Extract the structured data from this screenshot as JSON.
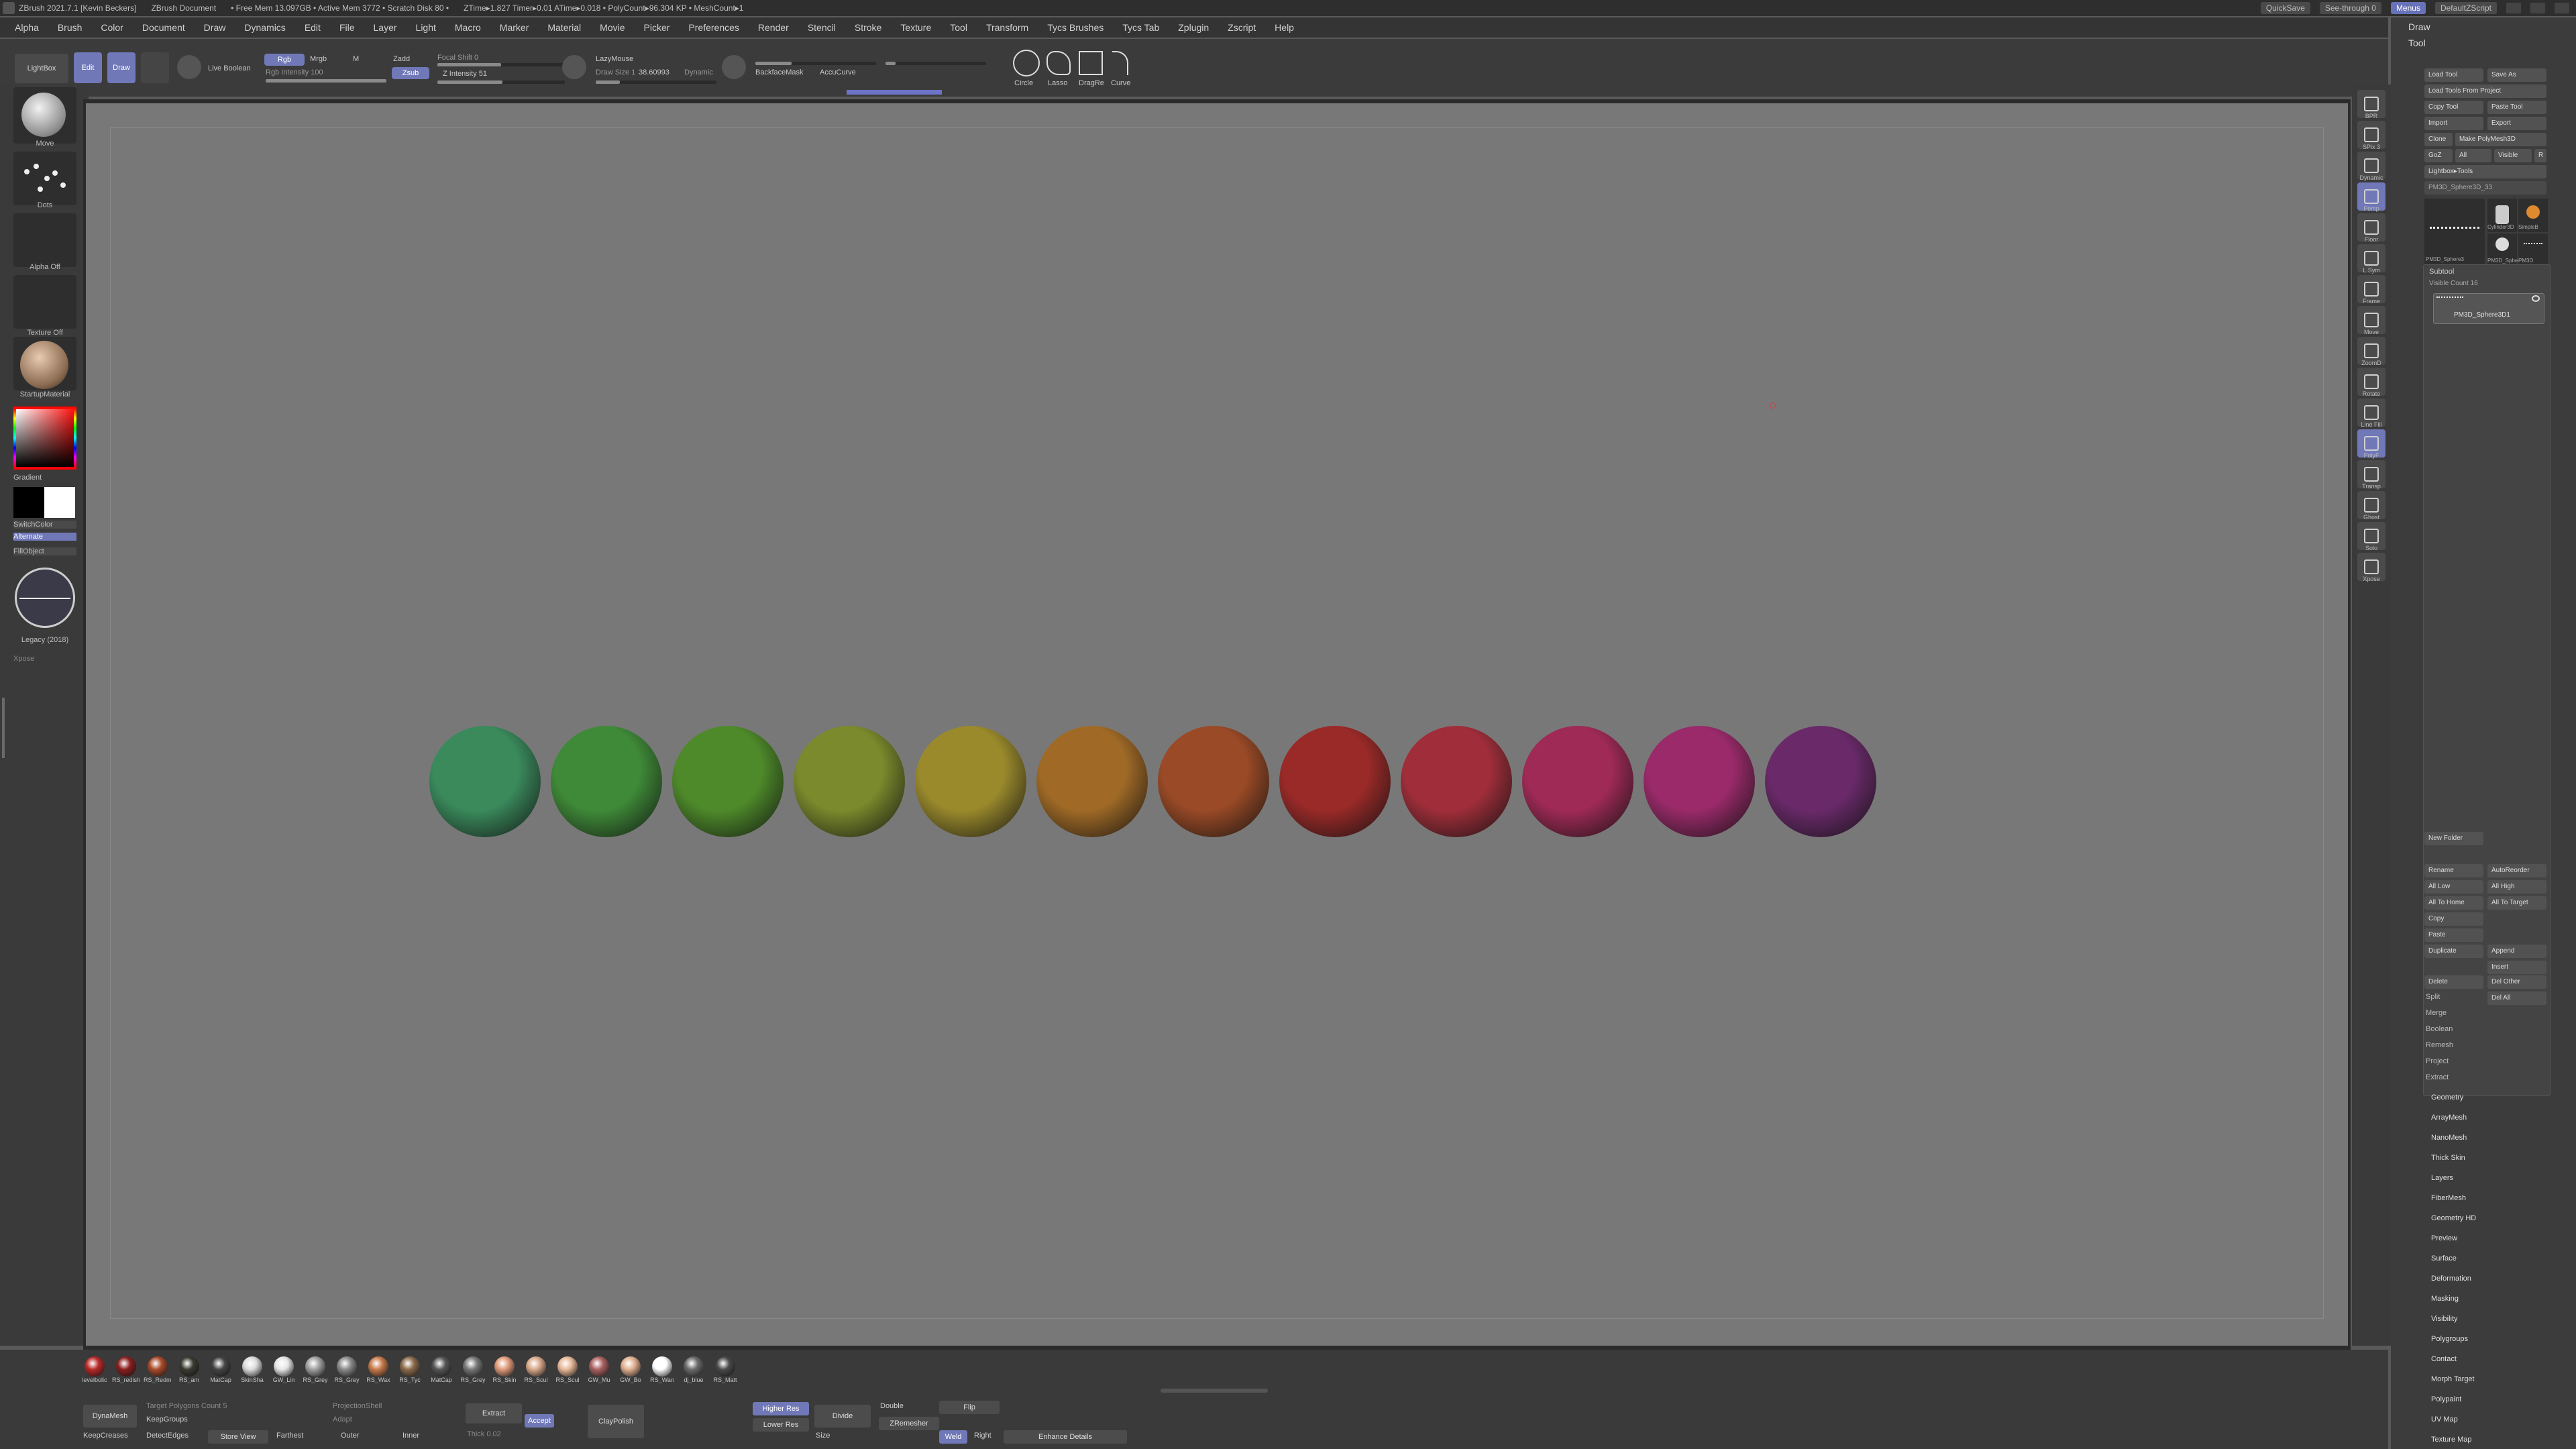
{
  "titlebar": {
    "app": "ZBrush 2021.7.1 [Kevin Beckers]",
    "document": "ZBrush Document",
    "stats": "• Free Mem 13.097GB • Active Mem 3772 • Scratch Disk 80 •",
    "timers": "ZTime▸1.827 Timer▸0.01 ATime▸0.018 • PolyCount▸96.304 KP • MeshCount▸1",
    "quicksave": "QuickSave",
    "seethrough": "See-through 0",
    "menus": "Menus",
    "script": "DefaultZScript"
  },
  "menus": [
    "Alpha",
    "Brush",
    "Color",
    "Document",
    "Draw",
    "Dynamics",
    "Edit",
    "File",
    "Layer",
    "Light",
    "Macro",
    "Marker",
    "Material",
    "Movie",
    "Picker",
    "Preferences",
    "Render",
    "Stencil",
    "Stroke",
    "Texture",
    "Tool",
    "Transform",
    "Tycs Brushes",
    "Tycs Tab",
    "Zplugin",
    "Zscript",
    "Help"
  ],
  "topshelf": {
    "lightbox": "LightBox",
    "edit": "Edit",
    "draw": "Draw",
    "live_boolean": "Live Boolean",
    "rgb": "Rgb",
    "mrgb": "Mrgb",
    "m": "M",
    "rgb_intensity": "Rgb Intensity 100",
    "zadd": "Zadd",
    "zsub": "Zsub",
    "focal_shift": "Focal Shift 0",
    "z_intensity": "Z Intensity 51",
    "draw_size": "Draw Size 1",
    "lazymouse": "LazyMouse",
    "lazyradius": "38.60993",
    "dynamic": "Dynamic",
    "backfacemask": "BackfaceMask",
    "accucurve": "AccuCurve",
    "strokes": [
      "Circle",
      "Lasso",
      "DragRe",
      "Curve"
    ]
  },
  "leftshelf": {
    "brush": "Move",
    "stroke": "Dots",
    "alpha": "Alpha Off",
    "texture": "Texture Off",
    "material": "StartupMaterial",
    "gradient": "Gradient",
    "switchcolor": "SwitchColor",
    "alternate": "Alternate",
    "fillobject": "FillObject",
    "legacy": "Legacy (2018)",
    "xpose": "Xpose"
  },
  "canvas": {
    "balls": [
      {
        "name": "teal-green",
        "color": "#3a8a5c"
      },
      {
        "name": "green",
        "color": "#3f8a38"
      },
      {
        "name": "grass-green",
        "color": "#4e8a2a"
      },
      {
        "name": "olive",
        "color": "#7a8a2c"
      },
      {
        "name": "mustard",
        "color": "#9a8a2c"
      },
      {
        "name": "ochre",
        "color": "#a06a26"
      },
      {
        "name": "rust",
        "color": "#9a4a26"
      },
      {
        "name": "red",
        "color": "#9a2a28"
      },
      {
        "name": "crimson",
        "color": "#a02e3a"
      },
      {
        "name": "raspberry",
        "color": "#a02a56"
      },
      {
        "name": "magenta",
        "color": "#9a2a6a"
      },
      {
        "name": "purple",
        "color": "#6a2a6a"
      }
    ]
  },
  "rightshelf": {
    "items": [
      "BPR",
      "SPix 3",
      "Dynamic",
      "Persp",
      "Floor",
      "L.Sym",
      "Frame",
      "Move",
      "ZoomD",
      "Rotate",
      "Line Fill",
      "PolyF",
      "Transp",
      "Ghost",
      "Solo",
      "Xpose"
    ]
  },
  "toolpanel": {
    "draw_header": "Draw",
    "tool_header": "Tool",
    "buttons": [
      "Load Tool",
      "Save As",
      "Load Tools From Project",
      "Copy Tool",
      "Paste Tool",
      "Import",
      "Export",
      "Clone",
      "Make PolyMesh3D",
      "GoZ",
      "All",
      "Visible",
      "R",
      "Lightbox▸Tools"
    ],
    "current_tool": "PM3D_Sphere3D_33",
    "thumbs": [
      "PM3D_Sphere3",
      "Cylinder3D",
      "SimpleB",
      "PM3D_Sphere3D",
      "PM3D"
    ],
    "subtool_header": "Subtool",
    "visible_count": "Visible Count 16",
    "subtool_name": "PM3D_Sphere3D1",
    "subtool_buttons": [
      "New Folder",
      "Rename",
      "AutoReorder",
      "All Low",
      "All High",
      "All To Home",
      "All To Target",
      "Copy",
      "Paste",
      "Duplicate",
      "Append",
      "Insert",
      "Delete",
      "Del Other",
      "Del All"
    ],
    "subtool_subs": [
      "Split",
      "Merge",
      "Boolean",
      "Remesh",
      "Project",
      "Extract"
    ],
    "sections": [
      "Geometry",
      "ArrayMesh",
      "NanoMesh",
      "Thick Skin",
      "Layers",
      "FiberMesh",
      "Geometry HD",
      "Preview",
      "Surface",
      "Deformation",
      "Masking",
      "Visibility",
      "Polygroups",
      "Contact",
      "Morph Target",
      "Polypaint",
      "UV Map",
      "Texture Map"
    ]
  },
  "materials": [
    {
      "label": "levelbolic",
      "color": "#b82828"
    },
    {
      "label": "RS_redish",
      "color": "#8a1e1e"
    },
    {
      "label": "RS_Redmet",
      "color": "#a84a2a"
    },
    {
      "label": "RS_am",
      "color": "#3a3a30"
    },
    {
      "label": "MatCap",
      "color": "#444444"
    },
    {
      "label": "SkinSha",
      "color": "#dcdcdc"
    },
    {
      "label": "GW_Lin",
      "color": "#e6e6e6"
    },
    {
      "label": "RS_Grey",
      "color": "#a0a0a0"
    },
    {
      "label": "RS_Grey",
      "color": "#8a8a8a"
    },
    {
      "label": "RS_Wax",
      "color": "#c87a4a"
    },
    {
      "label": "RS_Tyc",
      "color": "#8a6a4a"
    },
    {
      "label": "MatCap",
      "color": "#555555"
    },
    {
      "label": "RS_Grey",
      "color": "#777777"
    },
    {
      "label": "RS_Skin",
      "color": "#e09a7a"
    },
    {
      "label": "RS_Scul",
      "color": "#d8a88a"
    },
    {
      "label": "RS_Scul",
      "color": "#e8b898"
    },
    {
      "label": "GW_Mu",
      "color": "#aa6060"
    },
    {
      "label": "GW_Bo",
      "color": "#e0b090"
    },
    {
      "label": "RS_Wan",
      "color": "#ffffff"
    },
    {
      "label": "dj_blue",
      "color": "#6a6a6a"
    },
    {
      "label": "RS_Matt",
      "color": "#4a4a4a"
    }
  ],
  "bottomshelf": {
    "dynamesh": "DynaMesh",
    "target_polygons": "Target Polygons Count 5",
    "keepgroups": "KeepGroups",
    "keepcreases": "KeepCreases",
    "detectedges": "DetectEdges",
    "projectionshell": "ProjectionShell",
    "adaptive": "Adapt",
    "store_view": "Store View",
    "farthest": "Farthest",
    "outer": "Outer",
    "inner": "Inner",
    "extract": "Extract",
    "thick": "Thick 0.02",
    "accept": "Accept",
    "claypolish": "ClayPolish",
    "higher_res": "Higher Res",
    "lower_res": "Lower Res",
    "divide": "Divide",
    "double": "Double",
    "flip": "Flip",
    "zremesher": "ZRemesher",
    "size": "Size",
    "weld": "Weld",
    "right": "Right",
    "enhance": "Enhance Details"
  }
}
